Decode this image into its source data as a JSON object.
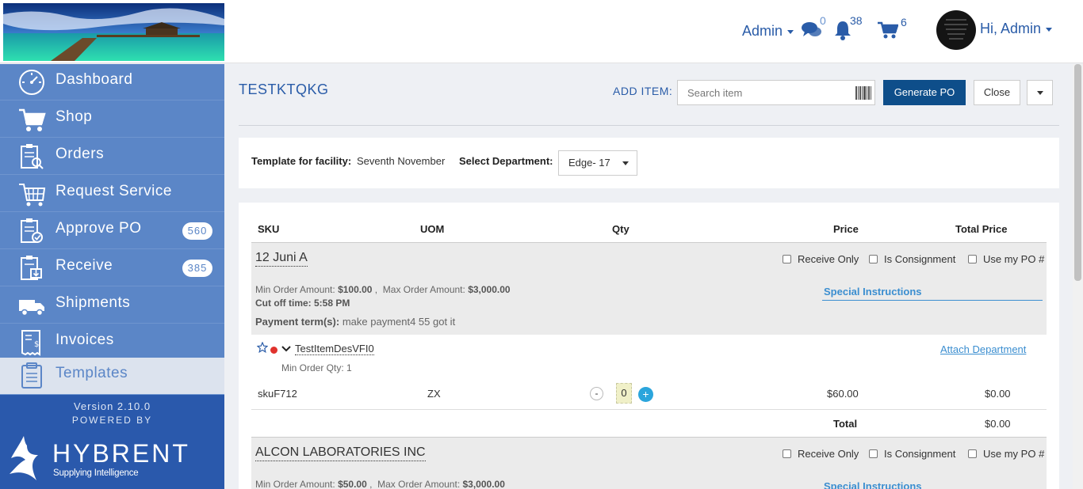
{
  "header": {
    "admin_menu": "Admin",
    "messages_count": "0",
    "notifications_count": "38",
    "cart_count": "6",
    "user_menu": "Hi, Admin"
  },
  "sidebar": {
    "items": [
      {
        "label": "Dashboard",
        "icon": "dashboard-icon"
      },
      {
        "label": "Shop",
        "icon": "cart-icon"
      },
      {
        "label": "Orders",
        "icon": "orders-icon"
      },
      {
        "label": "Request Service",
        "icon": "request-service-icon"
      },
      {
        "label": "Approve PO",
        "icon": "approve-po-icon",
        "badge": "560"
      },
      {
        "label": "Receive",
        "icon": "receive-icon",
        "badge": "385"
      },
      {
        "label": "Shipments",
        "icon": "truck-icon"
      },
      {
        "label": "Invoices",
        "icon": "invoice-icon"
      },
      {
        "label": "Templates",
        "icon": "templates-icon",
        "active": true
      }
    ],
    "version": "Version 2.10.0",
    "powered_by": "POWERED BY",
    "brand_name": "HYBRENT",
    "brand_tagline": "Supplying Intelligence"
  },
  "page": {
    "title": "TESTKTQKG",
    "add_item_label": "ADD ITEM:",
    "search_placeholder": "Search item",
    "generate_po": "Generate PO",
    "close": "Close"
  },
  "facility": {
    "label": "Template for facility:",
    "value": "Seventh November",
    "dept_label": "Select Department:",
    "dept_value": "Edge- 17"
  },
  "table": {
    "columns": {
      "sku": "SKU",
      "uom": "UOM",
      "qty": "Qty",
      "price": "Price",
      "total_price": "Total Price"
    },
    "vendors": [
      {
        "name": "12 Juni A",
        "receive_only": "Receive Only",
        "is_consignment": "Is Consignment",
        "use_my_po": "Use my PO #",
        "min_order_label": "Min Order Amount:",
        "min_order": "$100.00",
        "max_order_label": "Max Order Amount:",
        "max_order": "$3,000.00",
        "cutoff": "Cut off time: 5:58 PM",
        "payment_label": "Payment term(s):",
        "payment": "make payment4 55 got it",
        "special_instructions": "Special Instructions",
        "items": [
          {
            "name": "TestItemDesVFI0",
            "attach_department": "Attach Department",
            "min_qty": "Min Order Qty: 1",
            "sku": "skuF712",
            "uom": "ZX",
            "qty": "0",
            "qty_minus": "-",
            "qty_plus": "+",
            "price": "$60.00",
            "total": "$0.00"
          }
        ],
        "total_label": "Total",
        "total_value": "$0.00"
      },
      {
        "name": "ALCON LABORATORIES INC",
        "receive_only": "Receive Only",
        "is_consignment": "Is Consignment",
        "use_my_po": "Use my PO #",
        "min_order_label": "Min Order Amount:",
        "min_order": "$50.00",
        "max_order_label": "Max Order Amount:",
        "max_order": "$3,000.00",
        "special_instructions": "Special Instructions"
      }
    ]
  },
  "colors": {
    "brand_blue": "#2a5ca8",
    "sidebar_bg": "#5b86c7",
    "sidebar_footer": "#2a59ac",
    "primary_button": "#0e4e8a",
    "link": "#3b8ed0",
    "status_dot": "#e0322d"
  }
}
